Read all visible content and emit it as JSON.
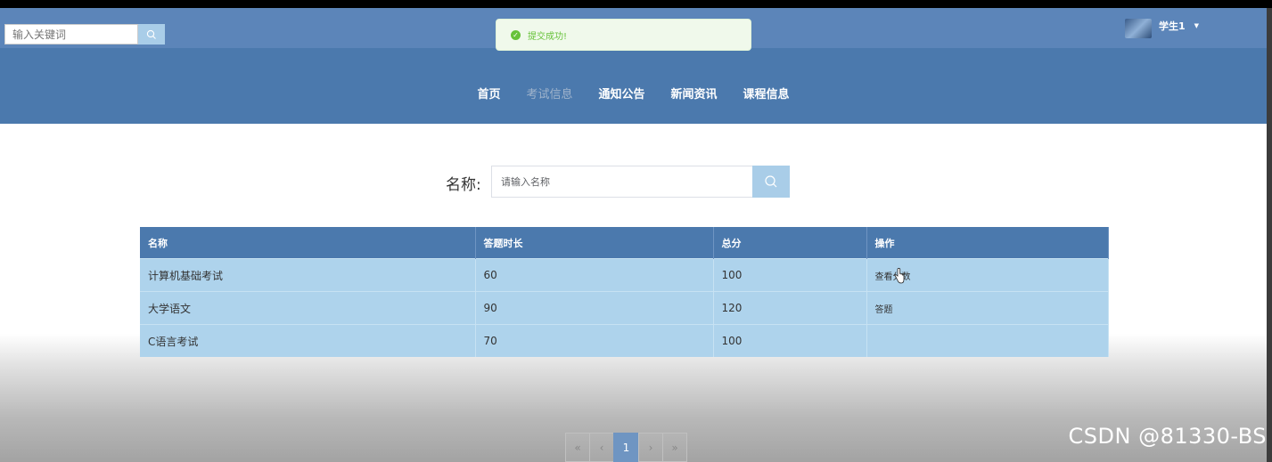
{
  "header": {
    "search_placeholder": "输入关键词",
    "toast_text": "提交成功!",
    "user_name": "学生1",
    "nav": [
      {
        "label": "首页",
        "active": false
      },
      {
        "label": "考试信息",
        "active": true
      },
      {
        "label": "通知公告",
        "active": false
      },
      {
        "label": "新闻资讯",
        "active": false
      },
      {
        "label": "课程信息",
        "active": false
      }
    ]
  },
  "filter": {
    "label": "名称:",
    "placeholder": "请输入名称"
  },
  "table": {
    "columns": [
      "名称",
      "答题时长",
      "总分",
      "操作"
    ],
    "rows": [
      {
        "name": "计算机基础考试",
        "duration": "60",
        "score": "100",
        "action": "查看分数"
      },
      {
        "name": "大学语文",
        "duration": "90",
        "score": "120",
        "action": "答题"
      },
      {
        "name": "C语言考试",
        "duration": "70",
        "score": "100",
        "action": ""
      }
    ]
  },
  "pagination": {
    "first": "«",
    "prev": "‹",
    "current": "1",
    "next": "›",
    "last": "»"
  },
  "watermark": "CSDN @81330-BS"
}
